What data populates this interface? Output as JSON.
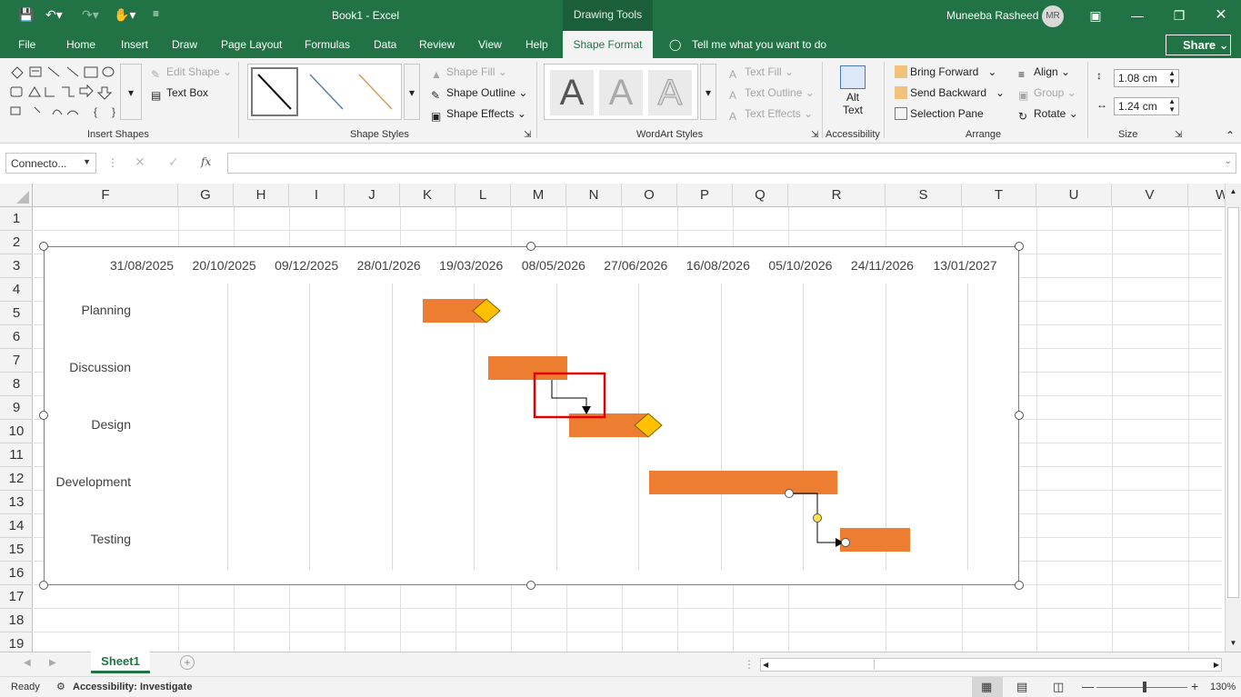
{
  "app": {
    "title": "Book1  -  Excel",
    "context_tool": "Drawing Tools",
    "user": "Muneeba Rasheed",
    "user_initials": "MR"
  },
  "tabs": [
    "File",
    "Home",
    "Insert",
    "Draw",
    "Page Layout",
    "Formulas",
    "Data",
    "Review",
    "View",
    "Help"
  ],
  "active_tab": "Shape Format",
  "tell_me": "Tell me what you want to do",
  "share": "Share",
  "ribbon": {
    "insert_shapes": {
      "label": "Insert Shapes",
      "edit_shape": "Edit Shape",
      "text_box": "Text Box"
    },
    "shape_styles": {
      "label": "Shape Styles",
      "fill": "Shape Fill",
      "outline": "Shape Outline",
      "effects": "Shape Effects"
    },
    "wordart": {
      "label": "WordArt Styles",
      "text_fill": "Text Fill",
      "text_outline": "Text Outline",
      "text_effects": "Text Effects",
      "sample": "A"
    },
    "accessibility": {
      "label": "Accessibility",
      "alt_text_1": "Alt",
      "alt_text_2": "Text"
    },
    "arrange": {
      "label": "Arrange",
      "bring_forward": "Bring Forward",
      "send_backward": "Send Backward",
      "selection_pane": "Selection Pane",
      "align": "Align",
      "group": "Group",
      "rotate": "Rotate"
    },
    "size": {
      "label": "Size",
      "height": "1.08 cm",
      "width": "1.24 cm"
    }
  },
  "formula_bar": {
    "name_box": "Connecto...",
    "fx": "fx"
  },
  "columns": [
    "F",
    "G",
    "H",
    "I",
    "J",
    "K",
    "L",
    "M",
    "N",
    "O",
    "P",
    "Q",
    "R",
    "S",
    "T",
    "U",
    "V"
  ],
  "rows": [
    "1",
    "2",
    "3",
    "4",
    "5",
    "6",
    "7",
    "8",
    "9",
    "10",
    "11",
    "12",
    "13",
    "14",
    "15",
    "16",
    "17",
    "18",
    "19"
  ],
  "chart_data": {
    "type": "bar",
    "subtype": "gantt",
    "x_tick_labels": [
      "31/08/2025",
      "20/10/2025",
      "09/12/2025",
      "28/01/2026",
      "19/03/2026",
      "08/05/2026",
      "27/06/2026",
      "16/08/2026",
      "05/10/2026",
      "24/11/2026",
      "13/01/2027"
    ],
    "xlim": [
      "2025-08-31",
      "2027-03-04"
    ],
    "categories": [
      "Planning",
      "Discussion",
      "Design",
      "Development",
      "Testing"
    ],
    "tasks": [
      {
        "name": "Planning",
        "start": "2026-03-12",
        "end": "2026-04-20",
        "milestone": true
      },
      {
        "name": "Discussion",
        "start": "2026-04-21",
        "end": "2026-06-08",
        "milestone": false
      },
      {
        "name": "Design",
        "start": "2026-06-09",
        "end": "2026-07-27",
        "milestone": true
      },
      {
        "name": "Development",
        "start": "2026-07-28",
        "end": "2026-11-19",
        "milestone": false
      },
      {
        "name": "Testing",
        "start": "2026-11-21",
        "end": "2027-01-02",
        "milestone": false
      }
    ],
    "grid": true,
    "colors": {
      "bar": "#ED7D31",
      "milestone": "#FFC000"
    }
  },
  "sheet_tabs": [
    "Sheet1"
  ],
  "status": {
    "ready": "Ready",
    "accessibility": "Accessibility: Investigate",
    "zoom": "130%"
  }
}
